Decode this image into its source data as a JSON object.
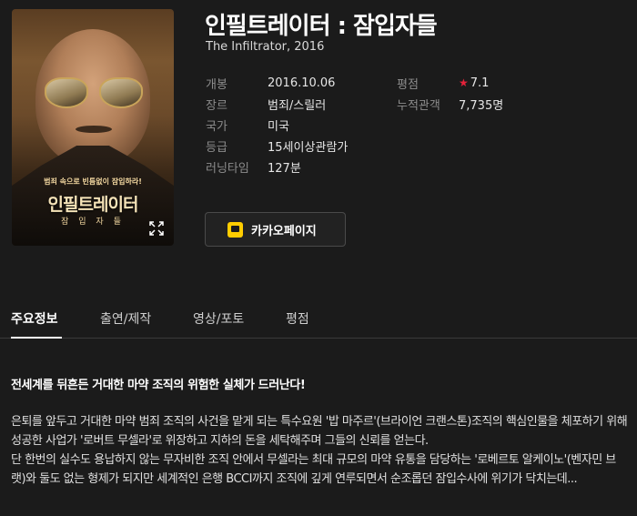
{
  "poster": {
    "tagline": "범죄 속으로 빈틈없이 잠입하라!",
    "title": "인필트레이터",
    "subtitle": "잠 입 자 들",
    "expand_icon": "expand-icon"
  },
  "movie": {
    "title": "인필트레이터 : 잠입자들",
    "original_title": "The Infiltrator, 2016"
  },
  "info_left": [
    {
      "key": "개봉",
      "value": "2016.10.06"
    },
    {
      "key": "장르",
      "value": "범죄/스릴러"
    },
    {
      "key": "국가",
      "value": "미국"
    },
    {
      "key": "등급",
      "value": "15세이상관람가"
    },
    {
      "key": "러닝타임",
      "value": "127분"
    }
  ],
  "info_right": {
    "rating_label": "평점",
    "rating_value": "7.1",
    "audience_label": "누적관객",
    "audience_value": "7,735명"
  },
  "kakao_button": {
    "label": "카카오페이지",
    "icon": "kakaopage-icon",
    "color": "#ffcd00"
  },
  "tabs": [
    {
      "label": "주요정보",
      "active": true
    },
    {
      "label": "출연/제작",
      "active": false
    },
    {
      "label": "영상/포토",
      "active": false
    },
    {
      "label": "평점",
      "active": false
    }
  ],
  "content": {
    "headline": "전세계를 뒤흔든 거대한 마약 조직의 위험한 실체가 드러난다!",
    "paragraph1": "은퇴를 앞두고 거대한 마약 범죄 조직의 사건을 맡게 되는 특수요원 '밥 마주르'(브라이언 크랜스톤)조직의 핵심인물을 체포하기 위해 성공한 사업가 '로버트 무셀라'로 위장하고 지하의 돈을 세탁해주며 그들의 신뢰를 얻는다.",
    "paragraph2": "단 한번의 실수도 용납하지 않는 무자비한 조직 안에서 무셀라는 최대 규모의 마약 유통을 담당하는 '로베르토 알케이노'(벤자민 브랫)와 둘도 없는 형제가 되지만 세계적인 은행 BCCI까지 조직에 깊게 연루되면서 순조롭던 잠입수사에 위기가 닥치는데..."
  },
  "colors": {
    "background": "#1b1b1b",
    "accent_star": "#e5223a"
  }
}
